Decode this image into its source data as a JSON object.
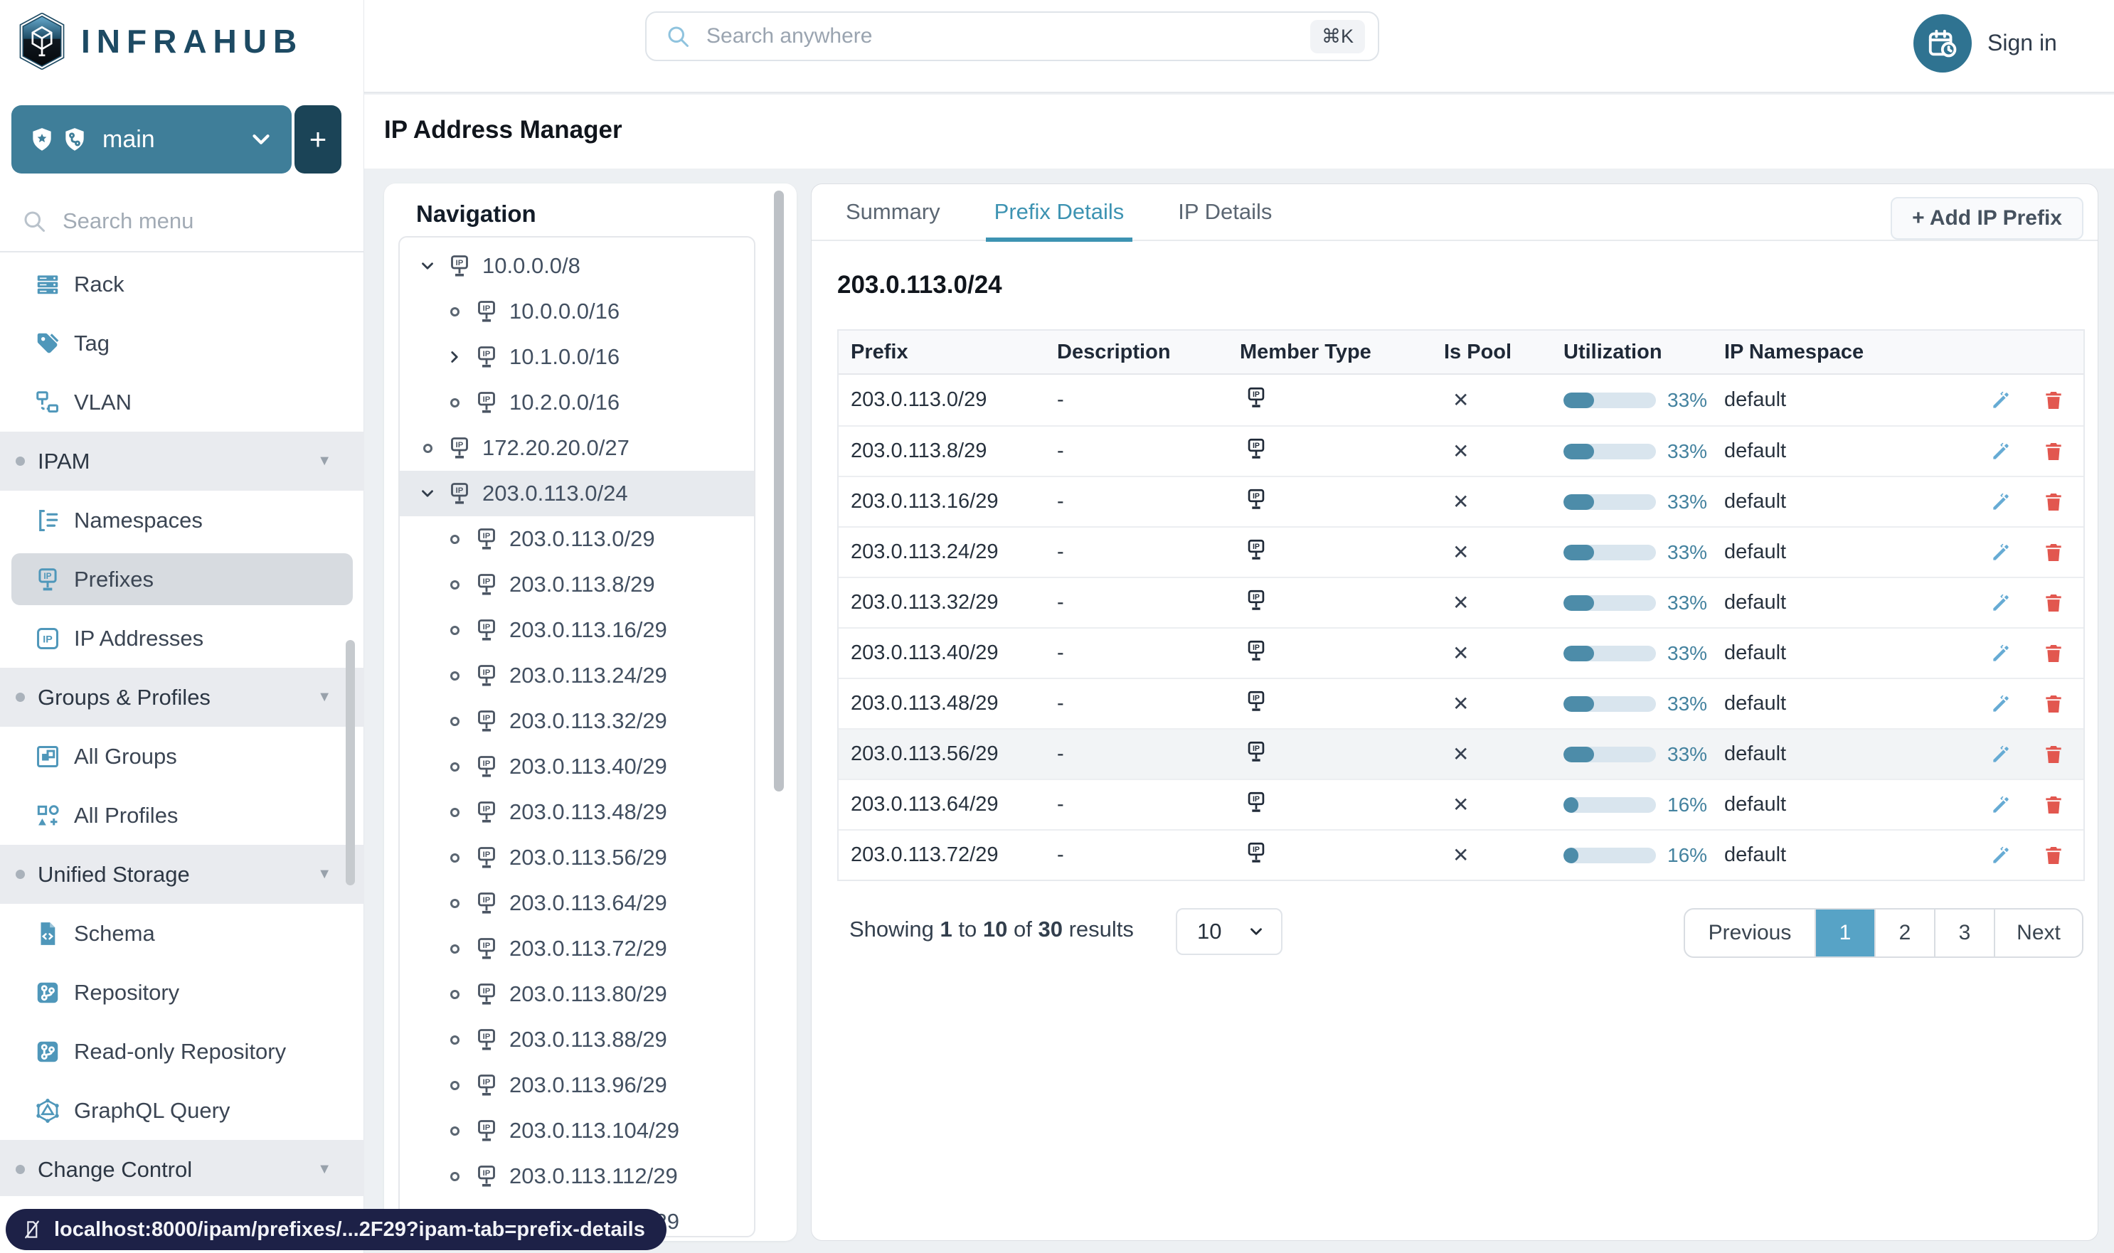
{
  "colors": {
    "teal": "#3f7e99",
    "teal_dark": "#1b4457",
    "accent": "#3d93b2",
    "icon_blue": "#4f97ba",
    "bar_fill": "#4d8ca9",
    "bar_track": "#d9e5ee",
    "page_active": "#57a3c6",
    "pencil": "#66abd4",
    "trash": "#e2574f",
    "status_pill": "#1d2147"
  },
  "header": {
    "logo_text": "INFRAHUB",
    "search_placeholder": "Search anywhere",
    "search_shortcut": "⌘K",
    "sign_in_label": "Sign in"
  },
  "sidebar": {
    "branch": {
      "name": "main",
      "add_label": "+"
    },
    "search_placeholder": "Search menu",
    "items": [
      {
        "type": "leaf",
        "icon": "rack-icon",
        "label": "Rack"
      },
      {
        "type": "leaf",
        "icon": "tag-icon",
        "label": "Tag"
      },
      {
        "type": "leaf",
        "icon": "vlan-icon",
        "label": "VLAN"
      },
      {
        "type": "section",
        "label": "IPAM"
      },
      {
        "type": "leaf",
        "icon": "namespace-icon",
        "label": "Namespaces"
      },
      {
        "type": "leaf",
        "icon": "prefix-icon",
        "label": "Prefixes",
        "active": true
      },
      {
        "type": "leaf",
        "icon": "ip-address-icon",
        "label": "IP Addresses"
      },
      {
        "type": "section",
        "label": "Groups & Profiles"
      },
      {
        "type": "leaf",
        "icon": "groups-icon",
        "label": "All Groups"
      },
      {
        "type": "leaf",
        "icon": "profiles-icon",
        "label": "All Profiles"
      },
      {
        "type": "section",
        "label": "Unified Storage"
      },
      {
        "type": "leaf",
        "icon": "schema-icon",
        "label": "Schema"
      },
      {
        "type": "leaf",
        "icon": "repository-icon",
        "label": "Repository"
      },
      {
        "type": "leaf",
        "icon": "readonly-repository-icon",
        "label": "Read-only Repository"
      },
      {
        "type": "leaf",
        "icon": "graphql-icon",
        "label": "GraphQL Query"
      },
      {
        "type": "section",
        "label": "Change Control"
      }
    ]
  },
  "page": {
    "title": "IP Address Manager"
  },
  "navigation": {
    "title": "Navigation",
    "tree": [
      {
        "level": 0,
        "marker": "expanded",
        "label": "10.0.0.0/8"
      },
      {
        "level": 1,
        "marker": "leaf",
        "label": "10.0.0.0/16"
      },
      {
        "level": 1,
        "marker": "collapsed",
        "label": "10.1.0.0/16"
      },
      {
        "level": 1,
        "marker": "leaf",
        "label": "10.2.0.0/16"
      },
      {
        "level": 0,
        "marker": "leaf",
        "label": "172.20.20.0/27"
      },
      {
        "level": 0,
        "marker": "expanded",
        "label": "203.0.113.0/24",
        "selected": true
      },
      {
        "level": 1,
        "marker": "leaf",
        "label": "203.0.113.0/29"
      },
      {
        "level": 1,
        "marker": "leaf",
        "label": "203.0.113.8/29"
      },
      {
        "level": 1,
        "marker": "leaf",
        "label": "203.0.113.16/29"
      },
      {
        "level": 1,
        "marker": "leaf",
        "label": "203.0.113.24/29"
      },
      {
        "level": 1,
        "marker": "leaf",
        "label": "203.0.113.32/29"
      },
      {
        "level": 1,
        "marker": "leaf",
        "label": "203.0.113.40/29"
      },
      {
        "level": 1,
        "marker": "leaf",
        "label": "203.0.113.48/29"
      },
      {
        "level": 1,
        "marker": "leaf",
        "label": "203.0.113.56/29"
      },
      {
        "level": 1,
        "marker": "leaf",
        "label": "203.0.113.64/29"
      },
      {
        "level": 1,
        "marker": "leaf",
        "label": "203.0.113.72/29"
      },
      {
        "level": 1,
        "marker": "leaf",
        "label": "203.0.113.80/29"
      },
      {
        "level": 1,
        "marker": "leaf",
        "label": "203.0.113.88/29"
      },
      {
        "level": 1,
        "marker": "leaf",
        "label": "203.0.113.96/29"
      },
      {
        "level": 1,
        "marker": "leaf",
        "label": "203.0.113.104/29"
      },
      {
        "level": 1,
        "marker": "leaf",
        "label": "203.0.113.112/29"
      },
      {
        "level": 1,
        "marker": "leaf",
        "label": "203.0.113.120/29"
      }
    ]
  },
  "main": {
    "tabs": [
      {
        "label": "Summary",
        "active": false
      },
      {
        "label": "Prefix Details",
        "active": true
      },
      {
        "label": "IP Details",
        "active": false
      }
    ],
    "add_button_label": "+ Add IP Prefix",
    "heading": "203.0.113.0/24",
    "table": {
      "columns": [
        "Prefix",
        "Description",
        "Member Type",
        "Is Pool",
        "Utilization",
        "IP Namespace"
      ],
      "rows": [
        {
          "prefix": "203.0.113.0/29",
          "description": "-",
          "member_type": "prefix",
          "is_pool": "✕",
          "utilization": 33,
          "utilization_label": "33%",
          "namespace": "default"
        },
        {
          "prefix": "203.0.113.8/29",
          "description": "-",
          "member_type": "prefix",
          "is_pool": "✕",
          "utilization": 33,
          "utilization_label": "33%",
          "namespace": "default"
        },
        {
          "prefix": "203.0.113.16/29",
          "description": "-",
          "member_type": "prefix",
          "is_pool": "✕",
          "utilization": 33,
          "utilization_label": "33%",
          "namespace": "default"
        },
        {
          "prefix": "203.0.113.24/29",
          "description": "-",
          "member_type": "prefix",
          "is_pool": "✕",
          "utilization": 33,
          "utilization_label": "33%",
          "namespace": "default"
        },
        {
          "prefix": "203.0.113.32/29",
          "description": "-",
          "member_type": "prefix",
          "is_pool": "✕",
          "utilization": 33,
          "utilization_label": "33%",
          "namespace": "default"
        },
        {
          "prefix": "203.0.113.40/29",
          "description": "-",
          "member_type": "prefix",
          "is_pool": "✕",
          "utilization": 33,
          "utilization_label": "33%",
          "namespace": "default"
        },
        {
          "prefix": "203.0.113.48/29",
          "description": "-",
          "member_type": "prefix",
          "is_pool": "✕",
          "utilization": 33,
          "utilization_label": "33%",
          "namespace": "default"
        },
        {
          "prefix": "203.0.113.56/29",
          "description": "-",
          "member_type": "prefix",
          "is_pool": "✕",
          "utilization": 33,
          "utilization_label": "33%",
          "namespace": "default",
          "highlight": true
        },
        {
          "prefix": "203.0.113.64/29",
          "description": "-",
          "member_type": "prefix",
          "is_pool": "✕",
          "utilization": 16,
          "utilization_label": "16%",
          "namespace": "default"
        },
        {
          "prefix": "203.0.113.72/29",
          "description": "-",
          "member_type": "prefix",
          "is_pool": "✕",
          "utilization": 16,
          "utilization_label": "16%",
          "namespace": "default"
        }
      ]
    },
    "footer": {
      "showing_word": "Showing",
      "from": "1",
      "to_word": "to",
      "to": "10",
      "of_word": "of",
      "total": "30",
      "results_word": "results",
      "page_size": "10"
    },
    "pagination": {
      "previous": "Previous",
      "pages": [
        "1",
        "2",
        "3"
      ],
      "active_page": "1",
      "next": "Next"
    }
  },
  "statusbar": {
    "url": "localhost:8000/ipam/prefixes/...2F29?ipam-tab=prefix-details"
  }
}
